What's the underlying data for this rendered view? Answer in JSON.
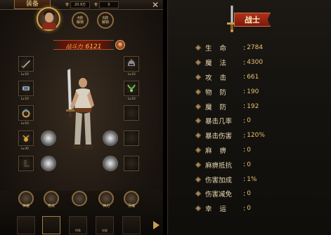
{
  "left_panel": {
    "title": "装备",
    "currency_1": {
      "icon": "gold-ingot-icon",
      "value": "20.9万"
    },
    "currency_2": {
      "icon": "coin-icon",
      "value": "0"
    },
    "tabs": [
      "4转\n解锁",
      "6转\n解锁"
    ],
    "combat_power": {
      "label": "战斗力",
      "value": "6121"
    },
    "left_slots": [
      {
        "name": "weapon",
        "level": "Lv.10"
      },
      {
        "name": "bracer",
        "level": "Lv.10"
      },
      {
        "name": "ring",
        "level": "Lv.10"
      },
      {
        "name": "amulet",
        "level": "Lv.30"
      },
      {
        "name": "boots",
        "level": ""
      }
    ],
    "right_slots": [
      {
        "name": "helmet",
        "level": "Lv.10"
      },
      {
        "name": "necklace",
        "level": "Lv.10"
      },
      {
        "name": "belt",
        "level": ""
      },
      {
        "name": "ring2",
        "level": ""
      },
      {
        "name": "cloak",
        "level": ""
      }
    ],
    "bottom_buttons": [
      "神装",
      "符文",
      "",
      "神力",
      "灵魂"
    ],
    "nav_items": [
      "",
      "",
      "特殊",
      "技能",
      ""
    ]
  },
  "right_panel": {
    "class_name": "战士",
    "stats": [
      {
        "name": "生命",
        "value": "2784",
        "spaced": true
      },
      {
        "name": "魔法",
        "value": "4300",
        "spaced": true
      },
      {
        "name": "攻击",
        "value": "661",
        "spaced": true
      },
      {
        "name": "物防",
        "value": "190",
        "spaced": true
      },
      {
        "name": "魔防",
        "value": "192",
        "spaced": true
      },
      {
        "name": "暴击几率",
        "value": "0",
        "spaced": false
      },
      {
        "name": "暴击伤害",
        "value": "120%",
        "spaced": false
      },
      {
        "name": "麻痹",
        "value": "0",
        "spaced": true
      },
      {
        "name": "麻痹抵抗",
        "value": "0",
        "spaced": false
      },
      {
        "name": "伤害加成",
        "value": "1%",
        "spaced": false
      },
      {
        "name": "伤害减免",
        "value": "0",
        "spaced": false
      },
      {
        "name": "幸运",
        "value": "0",
        "spaced": true
      }
    ]
  },
  "colors": {
    "accent_gold": "#e8c070",
    "banner_red": "#b03018"
  }
}
